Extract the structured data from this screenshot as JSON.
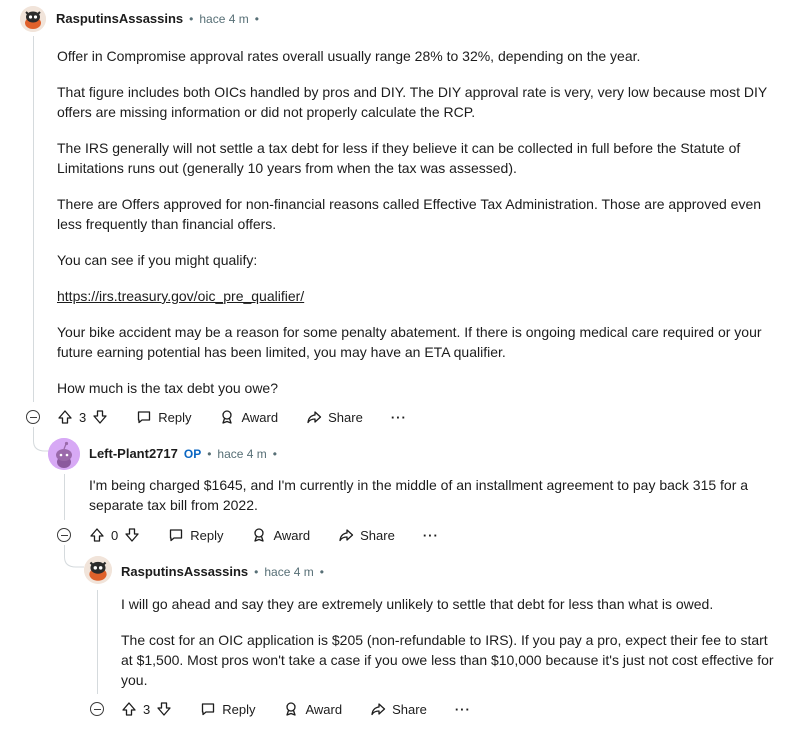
{
  "comment1": {
    "username": "RasputinsAssassins",
    "time": "hace 4 m",
    "paragraphs": [
      "Offer in Compromise approval rates overall usually range 28% to 32%, depending on the year.",
      "That figure includes both OICs handled by pros and DIY. The DIY approval rate is very, very low because most DIY offers are missing information or did not properly calculate the RCP.",
      "The IRS generally will not settle a tax debt for less if they believe it can be collected in full before the Statute of Limitations runs out (generally 10 years from when the tax was assessed).",
      "There are Offers approved for non-financial reasons called Effective Tax Administration. Those are approved even less frequently than financial offers.",
      "You can see if you might qualify:"
    ],
    "link": "https://irs.treasury.gov/oic_pre_qualifier/",
    "paragraphs_after": [
      "Your bike accident may be a reason for some penalty abatement. If there is ongoing medical care required or your future earning potential has been limited, you may have an ETA qualifier.",
      "How much is the tax debt you owe?"
    ],
    "votes": "3",
    "reply": "Reply",
    "award": "Award",
    "share": "Share",
    "more": "···"
  },
  "comment2": {
    "username": "Left-Plant2717",
    "op": "OP",
    "time": "hace 4 m",
    "paragraphs": [
      "I'm being charged $1645, and I'm currently in the middle of an installment agreement to pay back 315 for a separate tax bill from 2022."
    ],
    "votes": "0",
    "reply": "Reply",
    "award": "Award",
    "share": "Share",
    "more": "···"
  },
  "comment3": {
    "username": "RasputinsAssassins",
    "time": "hace 4 m",
    "paragraphs": [
      "I will go ahead and say they are extremely unlikely to settle that debt for less than what is owed.",
      "The cost for an OIC application is $205 (non-refundable to IRS). If you pay a pro, expect their fee to start at $1,500. Most pros won't take a case if you owe less than $10,000 because it's just not cost effective for you."
    ],
    "votes": "3",
    "reply": "Reply",
    "award": "Award",
    "share": "Share",
    "more": "···"
  },
  "separator": "•",
  "colors": {
    "text": "#1c1c1c",
    "meta": "#576f76",
    "op": "#0a66c2",
    "avatar_bg_purple": "#d7a9f5",
    "thread_line": "#d5dadd"
  }
}
